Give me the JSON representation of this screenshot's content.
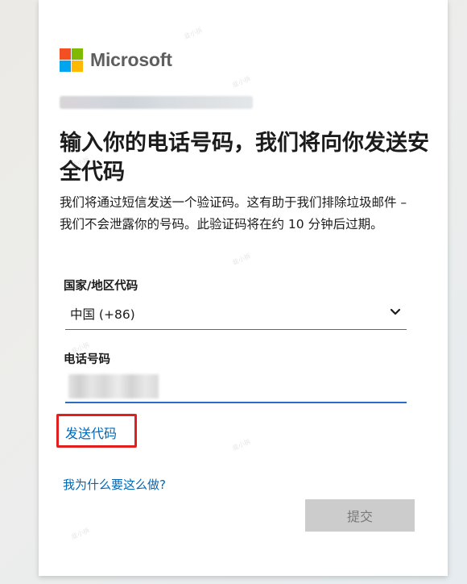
{
  "brand": {
    "name": "Microsoft",
    "logo_colors": [
      "#f25022",
      "#7fba00",
      "#00a4ef",
      "#ffb900"
    ]
  },
  "title": "输入你的电话号码，我们将向你发送安全代码",
  "description": "我们将通过短信发送一个验证码。这有助于我们排除垃圾邮件 – 我们不会泄露你的号码。此验证码将在约 10 分钟后过期。",
  "country_field": {
    "label": "国家/地区代码",
    "selected": "中国 (+86)"
  },
  "phone_field": {
    "label": "电话号码"
  },
  "send_code_link": "发送代码",
  "why_link": "我为什么要这么做?",
  "submit_button": "提交",
  "watermark": "韭小拆"
}
